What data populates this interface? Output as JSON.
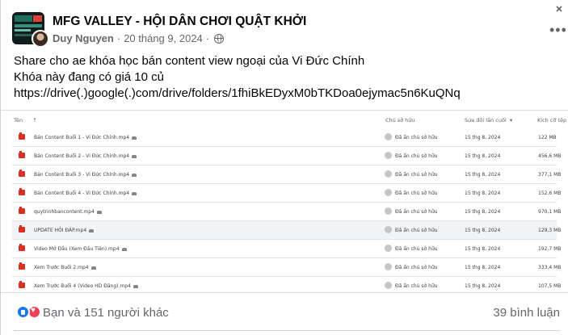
{
  "post": {
    "group_name": "MFG VALLEY - HỘI DÂN CHƠI QUẬT KHỞI",
    "author": "Duy Nguyen",
    "separator": "·",
    "date": "20 tháng 9, 2024",
    "more_label": "•••",
    "text_lines": [
      "Share cho ae khóa học bán content view ngoại của Vi Đức Chính",
      "Khóa này đang có giá 10 củ",
      "https://drive(.)google(.)com/drive/folders/1fhiBkEDyxM0bTKDoa0ejymac5n6KuQNq"
    ]
  },
  "drive": {
    "columns": {
      "name": "Tên",
      "owner": "Chủ sở hữu",
      "modified": "Sửa đổi lần cuối",
      "size": "Kích cỡ tệp"
    },
    "files": [
      {
        "name": "Bán Content Buổi 1 - Vi Đức Chính.mp4",
        "owner": "Đã ẩn chủ sở hữu",
        "modified": "15 thg 8, 2024",
        "size": "122 MB"
      },
      {
        "name": "Bán Content Buổi 2 - Vi Đức Chính.mp4",
        "owner": "Đã ẩn chủ sở hữu",
        "modified": "15 thg 8, 2024",
        "size": "456,6 MB"
      },
      {
        "name": "Bán Content Buổi 3 - Vi Đức Chính.mp4",
        "owner": "Đã ẩn chủ sở hữu",
        "modified": "15 thg 8, 2024",
        "size": "377,1 MB"
      },
      {
        "name": "Bán Content Buổi 4 - Vi Đức Chính.mp4",
        "owner": "Đã ẩn chủ sở hữu",
        "modified": "15 thg 8, 2024",
        "size": "152,6 MB"
      },
      {
        "name": "quytrinhbancontent.mp4",
        "owner": "Đã ẩn chủ sở hữu",
        "modified": "15 thg 8, 2024",
        "size": "970,1 MB"
      },
      {
        "name": "UPDATE HỎI ĐÁP.mp4",
        "owner": "Đã ẩn chủ sở hữu",
        "modified": "15 thg 8, 2024",
        "size": "129,3 MB"
      },
      {
        "name": "Video Mở Đầu (Xem Đầu Tiên).mp4",
        "owner": "Đã ẩn chủ sở hữu",
        "modified": "15 thg 8, 2024",
        "size": "192,7 MB"
      },
      {
        "name": "Xem Trước Buổi 2.mp4",
        "owner": "Đã ẩn chủ sở hữu",
        "modified": "15 thg 8, 2024",
        "size": "333,4 MB"
      },
      {
        "name": "Xem Trước Buổi 4 (Video HD Đăng).mp4",
        "owner": "Đã ẩn chủ sở hữu",
        "modified": "15 thg 8, 2024",
        "size": "107,5 MB"
      }
    ]
  },
  "footer": {
    "reactions": "Bạn và 151 người khác",
    "comments": "39 bình luận"
  },
  "colors": {
    "accent": "#1877f2",
    "love": "#f33e58",
    "drive_file": "#d93025"
  },
  "icons": [
    "globe-icon",
    "more-icon",
    "close-icon",
    "like-icon",
    "love-icon",
    "video-file-icon",
    "owner-avatar-icon",
    "shared-icon"
  ]
}
